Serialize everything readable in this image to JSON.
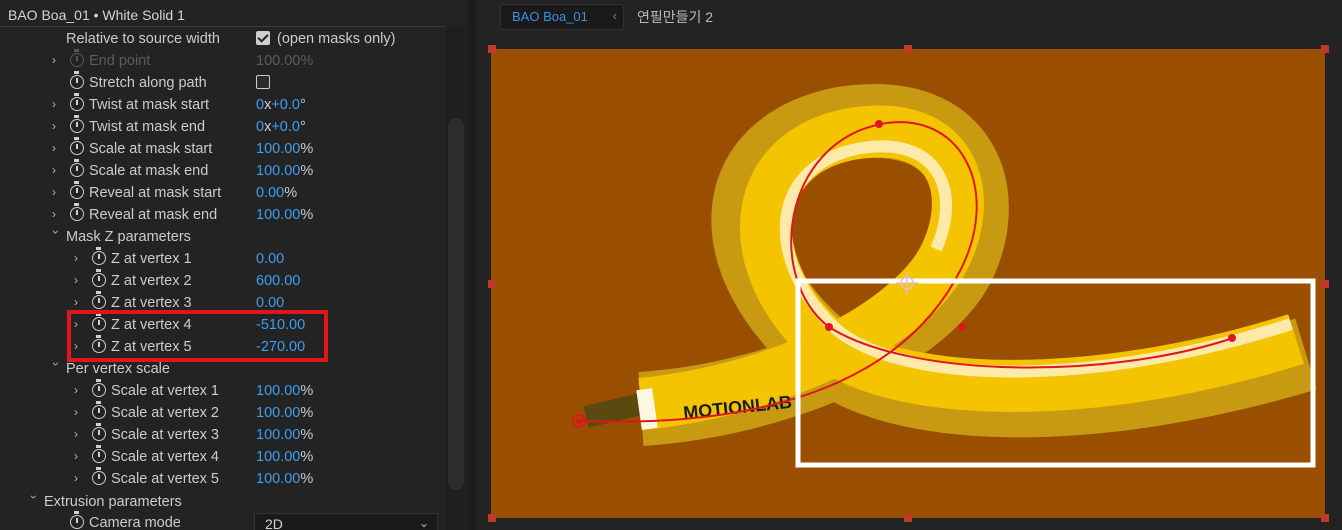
{
  "panel": {
    "title": "BAO Boa_01 • White Solid 1"
  },
  "rows": {
    "relative": {
      "label": "Relative to source width",
      "value": "(open masks only)"
    },
    "end_point": {
      "label": "End point",
      "value": "100.00%"
    },
    "stretch": {
      "label": "Stretch along path"
    },
    "twist_start": {
      "label": "Twist at mask start",
      "num": "0",
      "mid": "x",
      "num2": "+0.0",
      "unit": "°"
    },
    "twist_end": {
      "label": "Twist at mask end",
      "num": "0",
      "mid": "x",
      "num2": "+0.0",
      "unit": "°"
    },
    "scale_start": {
      "label": "Scale at mask start",
      "value": "100.00",
      "unit": "%"
    },
    "scale_end": {
      "label": "Scale at mask end",
      "value": "100.00",
      "unit": "%"
    },
    "reveal_start": {
      "label": "Reveal at mask start",
      "value": "0.00",
      "unit": "%"
    },
    "reveal_end": {
      "label": "Reveal at mask end",
      "value": "100.00",
      "unit": "%"
    },
    "mask_z": {
      "label": "Mask Z parameters"
    },
    "z1": {
      "label": "Z at vertex 1",
      "value": "0.00"
    },
    "z2": {
      "label": "Z at vertex 2",
      "value": "600.00"
    },
    "z3": {
      "label": "Z at vertex 3",
      "value": "0.00"
    },
    "z4": {
      "label": "Z at vertex 4",
      "value": "-510.00"
    },
    "z5": {
      "label": "Z at vertex 5",
      "value": "-270.00"
    },
    "per_vertex": {
      "label": "Per vertex scale"
    },
    "s1": {
      "label": "Scale at vertex 1",
      "value": "100.00",
      "unit": "%"
    },
    "s2": {
      "label": "Scale at vertex 2",
      "value": "100.00",
      "unit": "%"
    },
    "s3": {
      "label": "Scale at vertex 3",
      "value": "100.00",
      "unit": "%"
    },
    "s4": {
      "label": "Scale at vertex 4",
      "value": "100.00",
      "unit": "%"
    },
    "s5": {
      "label": "Scale at vertex 5",
      "value": "100.00",
      "unit": "%"
    },
    "extrusion": {
      "label": "Extrusion parameters"
    },
    "camera": {
      "label": "Camera mode",
      "value": "2D"
    }
  },
  "viewer": {
    "tab_label": "BAO Boa_01",
    "breadcrumb": "연필만들기 2",
    "brand_text": "MOTIONLAB"
  },
  "colors": {
    "accent": "#3d9ff0",
    "highlight": "#e0151e",
    "comp_bg": "#9a4f00",
    "tube_yellow": "#f4c400",
    "tube_shadow": "#c79a12",
    "tube_light": "#fde9a8"
  },
  "icons": [
    "chevron-right-icon",
    "chevron-down-icon",
    "stopwatch-icon",
    "checkbox-icon",
    "anchor-point-icon"
  ]
}
